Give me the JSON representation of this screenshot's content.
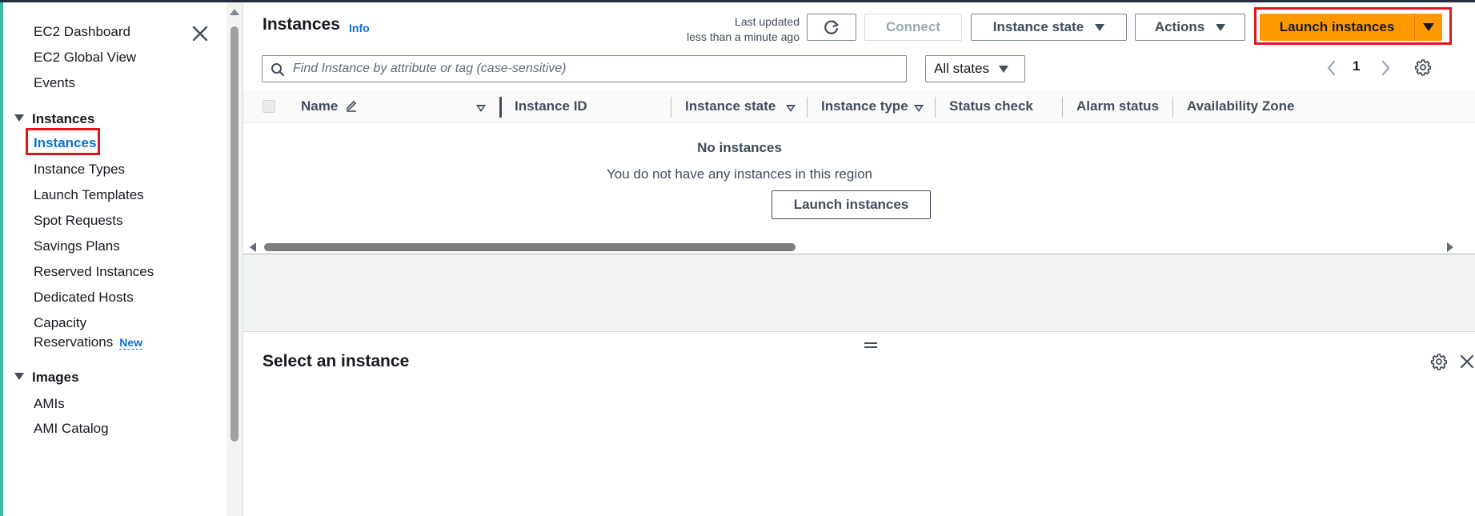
{
  "sidebar": {
    "top_items": [
      {
        "label": "EC2 Dashboard"
      },
      {
        "label": "EC2 Global View"
      },
      {
        "label": "Events"
      }
    ],
    "sections": [
      {
        "title": "Instances",
        "items": [
          {
            "label": "Instances",
            "active": true
          },
          {
            "label": "Instance Types"
          },
          {
            "label": "Launch Templates"
          },
          {
            "label": "Spot Requests"
          },
          {
            "label": "Savings Plans"
          },
          {
            "label": "Reserved Instances"
          },
          {
            "label": "Dedicated Hosts"
          },
          {
            "label": "Capacity",
            "label_line2": "Reservations",
            "badge": "New"
          }
        ]
      },
      {
        "title": "Images",
        "items": [
          {
            "label": "AMIs"
          },
          {
            "label": "AMI Catalog"
          }
        ]
      }
    ],
    "close_icon": "close-icon"
  },
  "header": {
    "title": "Instances",
    "info_link": "Info",
    "last_updated_line1": "Last updated",
    "last_updated_line2": "less than a minute ago",
    "refresh_icon": "refresh-icon",
    "connect_label": "Connect",
    "instance_state_label": "Instance state",
    "actions_label": "Actions",
    "launch_label": "Launch instances"
  },
  "filter": {
    "search_placeholder": "Find Instance by attribute or tag (case-sensitive)",
    "search_value": "",
    "states_label": "All states",
    "page_number": "1"
  },
  "table": {
    "columns": [
      {
        "label": "Name"
      },
      {
        "label": "Instance ID"
      },
      {
        "label": "Instance state"
      },
      {
        "label": "Instance type"
      },
      {
        "label": "Status check"
      },
      {
        "label": "Alarm status"
      },
      {
        "label": "Availability Zone"
      }
    ],
    "rows": [],
    "empty_title": "No instances",
    "empty_message": "You do not have any instances in this region",
    "empty_button": "Launch instances"
  },
  "details_panel": {
    "title": "Select an instance"
  },
  "colors": {
    "accent": "#0972d3",
    "primary_button": "#ff9900",
    "highlight": "#e0161e"
  }
}
